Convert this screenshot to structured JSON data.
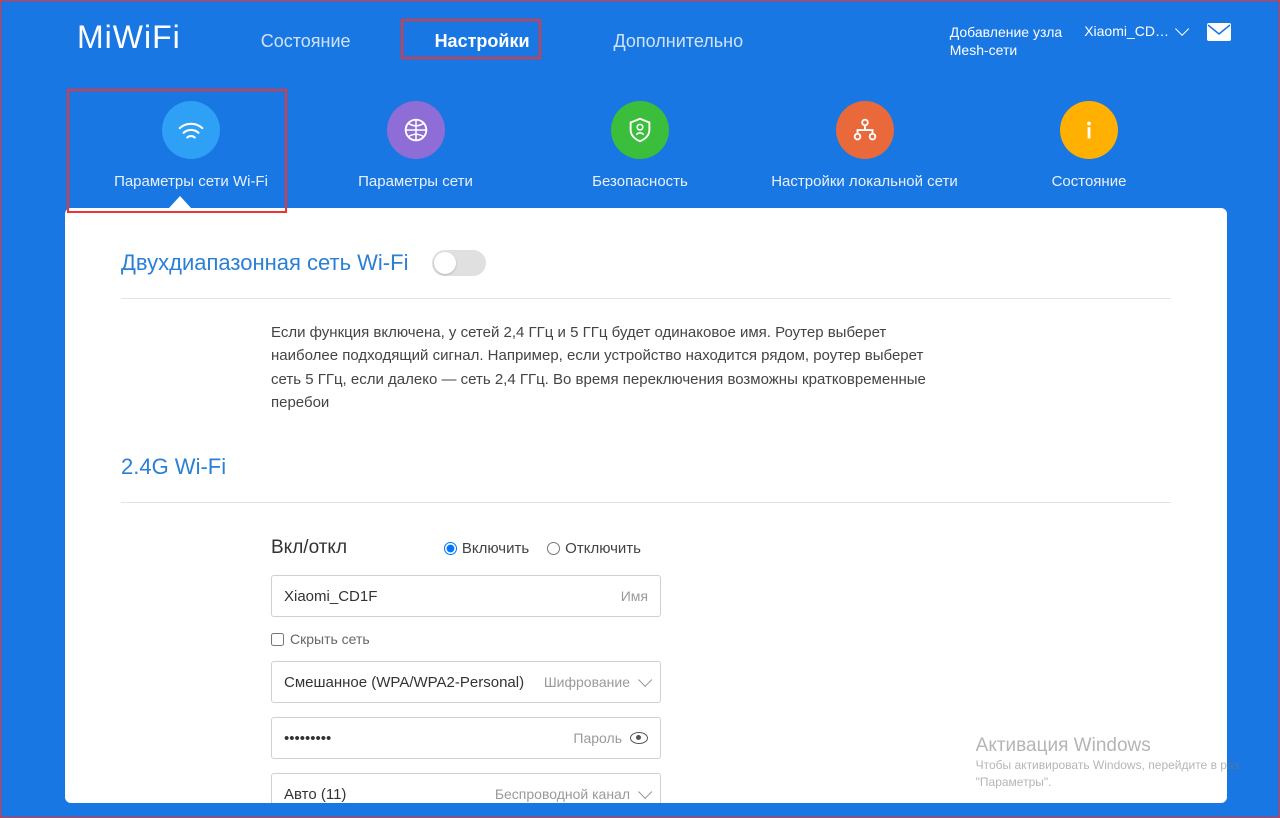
{
  "logo": "MiWiFi",
  "nav": {
    "status": "Состояние",
    "settings": "Настройки",
    "advanced": "Дополнительно"
  },
  "topright": {
    "mesh1": "Добавление узла",
    "mesh2": "Mesh-сети",
    "device": "Xiaomi_CD…"
  },
  "subtabs": {
    "wifi": "Параметры сети Wi-Fi",
    "network": "Параметры сети",
    "security": "Безопасность",
    "lan": "Настройки локальной сети",
    "status": "Состояние"
  },
  "dualband": {
    "title": "Двухдиапазонная сеть Wi-Fi",
    "desc": "Если функция включена, у сетей 2,4 ГГц и 5 ГГц будет одинаковое имя. Роутер выберет наиболее подходящий сигнал. Например, если устройство находится рядом, роутер выберет сеть 5 ГГц, если далеко — сеть 2,4 ГГц. Во время переключения возможны кратковременные перебои"
  },
  "wifi24": {
    "title": "2.4G Wi-Fi",
    "onoff_label": "Вкл/откл",
    "on": "Включить",
    "off": "Отключить",
    "name_value": "Xiaomi_CD1F",
    "name_suffix": "Имя",
    "hide": "Скрыть сеть",
    "enc_value": "Смешанное (WPA/WPA2-Personal)",
    "enc_suffix": "Шифрование",
    "pwd_value": "•••••••••",
    "pwd_suffix": "Пароль",
    "chan_value": "Авто (11)",
    "chan_suffix": "Беспроводной канал"
  },
  "watermark": {
    "l1": "Активация Windows",
    "l2a": "Чтобы активировать Windows, перейдите в раз",
    "l2b": "\"Параметры\"."
  }
}
